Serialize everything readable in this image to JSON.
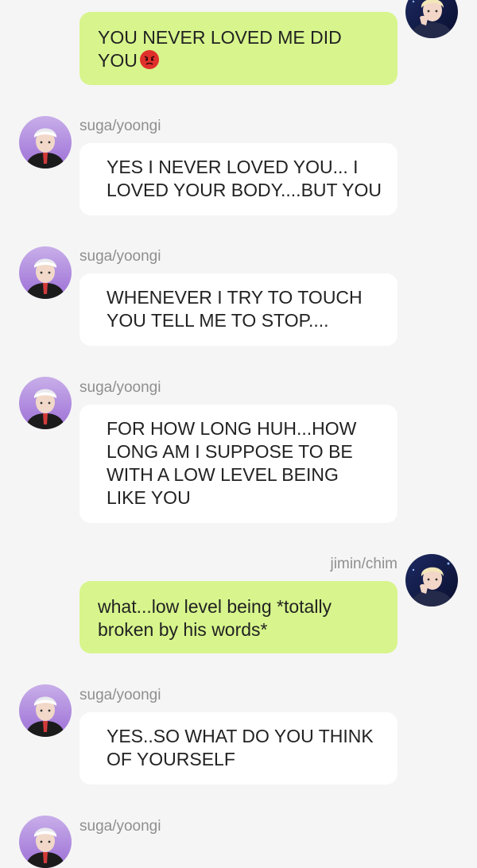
{
  "contacts": {
    "suga": {
      "name": "suga/yoongi"
    },
    "jimin": {
      "name": "jimin/chim"
    }
  },
  "messages": [
    {
      "from": "jimin",
      "text": "YOU NEVER LOVED ME DID YOU",
      "emoji": "pouting-face-emoji"
    },
    {
      "from": "suga",
      "text": "YES I NEVER LOVED YOU... I LOVED YOUR BODY....BUT YOU"
    },
    {
      "from": "suga",
      "text": "WHENEVER I TRY TO TOUCH YOU TELL ME TO STOP...."
    },
    {
      "from": "suga",
      "text": "FOR HOW LONG HUH...HOW LONG AM I SUPPOSE TO BE WITH A LOW LEVEL BEING LIKE YOU"
    },
    {
      "from": "jimin",
      "text": "what...low level being *totally broken by his words*"
    },
    {
      "from": "suga",
      "text": "YES..SO WHAT DO YOU THINK OF YOURSELF"
    },
    {
      "from": "suga",
      "text": ""
    }
  ],
  "colors": {
    "background": "#f5f5f5",
    "incoming_bubble": "#ffffff",
    "outgoing_bubble": "#d7f58c",
    "name_text": "#8f8f8f"
  }
}
